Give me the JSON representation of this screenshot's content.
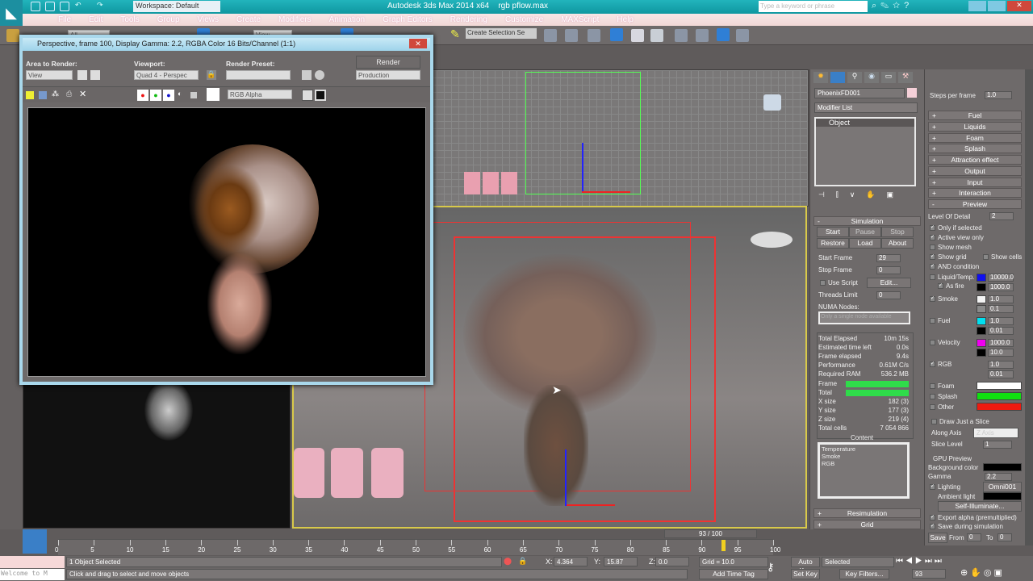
{
  "app": {
    "workspace": "Workspace: Default",
    "title": "Autodesk 3ds Max 2014 x64",
    "file": "rgb pflow.max",
    "search_placeholder": "Type a keyword or phrase"
  },
  "menu": [
    "File",
    "Edit",
    "Tools",
    "Group",
    "Views",
    "Create",
    "Modifiers",
    "Animation",
    "Graph Editors",
    "Rendering",
    "Customize",
    "MAXScript",
    "Help"
  ],
  "toolbar": {
    "filter": "All",
    "view": "View",
    "selection_set": "Create Selection Se"
  },
  "render_window": {
    "title": "Perspective, frame 100, Display Gamma: 2.2, RGBA Color 16 Bits/Channel (1:1)",
    "area_label": "Area to Render:",
    "area_value": "View",
    "viewport_label": "Viewport:",
    "viewport_value": "Quad 4 - Perspec",
    "preset_label": "Render Preset:",
    "preset_value": "",
    "render_label": "Render",
    "render_mode": "Production",
    "channel": "RGB Alpha"
  },
  "command_panel": {
    "object_name": "PhoenixFD001",
    "modifier_list": "Modifier List",
    "stack": [
      "Object"
    ],
    "simulation": {
      "title": "Simulation",
      "buttons": [
        "Start",
        "Pause",
        "Stop",
        "Restore",
        "Load",
        "About"
      ],
      "start_frame_label": "Start Frame",
      "start_frame": "29",
      "stop_frame_label": "Stop Frame",
      "stop_frame": "0",
      "use_script": "Use Script",
      "edit": "Edit...",
      "threads_label": "Threads Limit",
      "threads": "0",
      "numa_label": "NUMA Nodes:",
      "numa_placeholder": "Only a single node available",
      "stats": [
        [
          "Total Elapsed",
          "10m 15s"
        ],
        [
          "Estimated time left",
          "0.0s"
        ],
        [
          "Frame elapsed",
          "9.4s"
        ],
        [
          "Performance",
          "0.61M C/s"
        ],
        [
          "Required RAM",
          "536.2 MB"
        ]
      ],
      "frame_label": "Frame",
      "total_label": "Total",
      "frame_progress": 100,
      "total_progress": 100,
      "sizes": [
        [
          "X size",
          "182 (3)"
        ],
        [
          "Y size",
          "177 (3)"
        ],
        [
          "Z size",
          "219 (4)"
        ],
        [
          "Total cells",
          "7 054 866"
        ]
      ],
      "content_label": "Content",
      "content": [
        "Temperature",
        "Smoke",
        "RGB"
      ]
    },
    "collapsed": [
      "Resimulation",
      "Grid"
    ]
  },
  "rollouts": {
    "steps_label": "Steps per frame",
    "steps": "1.0",
    "collapsed": [
      "Fuel",
      "Liquids",
      "Foam",
      "Splash",
      "Attraction effect",
      "Output",
      "Input",
      "Interaction"
    ],
    "preview": "Preview",
    "lod_label": "Level Of Detail",
    "lod": "2",
    "checks": [
      [
        "Only if selected",
        true
      ],
      [
        "Active view only",
        true
      ],
      [
        "Show mesh",
        false
      ],
      [
        "Show grid",
        true
      ],
      [
        "AND condition",
        true
      ]
    ],
    "show_cells": "Show cells",
    "channels": [
      {
        "label": "Liquid/Temp.",
        "checked": false,
        "color": "#1010f0",
        "v1": "10000.0",
        "color2": "#000000",
        "v2": "1000.0"
      },
      {
        "label": "Smoke",
        "checked": true,
        "color": "#f4f4f4",
        "v1": "1.0",
        "color2": "#8a8a8a",
        "v2": "0.1"
      },
      {
        "label": "Fuel",
        "checked": false,
        "color": "#00e0f0",
        "v1": "1.0",
        "color2": "#000000",
        "v2": "0.01"
      },
      {
        "label": "Velocity",
        "checked": false,
        "color": "#f000f0",
        "v1": "1000.0",
        "color2": "#000000",
        "v2": "10.0"
      },
      {
        "label": "RGB",
        "checked": true,
        "color": "",
        "v1": "1.0",
        "color2": "",
        "v2": "0.01"
      }
    ],
    "as_fire": "As fire",
    "particles": [
      {
        "label": "Foam",
        "color": "#ffffff"
      },
      {
        "label": "Splash",
        "color": "#10e010"
      },
      {
        "label": "Other",
        "color": "#ee1a10"
      }
    ],
    "slice": {
      "title": "Draw Just a Slice",
      "axis_label": "Along Axis",
      "axis": "Z Axis",
      "level_label": "Slice Level",
      "level": "1"
    },
    "gpu": {
      "title": "GPU Preview",
      "bg_label": "Background color",
      "gamma_label": "Gamma",
      "gamma": "2.2",
      "lighting": "Lighting",
      "light": "Omni001",
      "ambient": "Ambient light",
      "self_illum": "Self-Illuminate...",
      "export_alpha": "Export alpha (premultiplied)",
      "save_during": "Save during simulation",
      "save": "Save",
      "from_label": "From",
      "from": "0",
      "to_label": "To",
      "to": "0"
    }
  },
  "timeline": {
    "position": "93 / 100",
    "current": 93,
    "max": 100,
    "ticks": [
      0,
      5,
      10,
      15,
      20,
      25,
      30,
      35,
      40,
      45,
      50,
      55,
      60,
      65,
      70,
      75,
      80,
      85,
      90,
      95,
      100
    ]
  },
  "status": {
    "selected": "1 Object Selected",
    "prompt": "Click and drag to select and move objects",
    "maxscript": "Welcome to M",
    "x_label": "X:",
    "x": "4.364",
    "y_label": "Y:",
    "y": "15.87",
    "z_label": "Z:",
    "z": "0.0",
    "grid": "Grid = 10.0",
    "add_time_tag": "Add Time Tag",
    "auto_key": "Auto Key",
    "set_key": "Set Key",
    "key_mode": "Selected",
    "key_filters": "Key Filters...",
    "frame": "93"
  }
}
